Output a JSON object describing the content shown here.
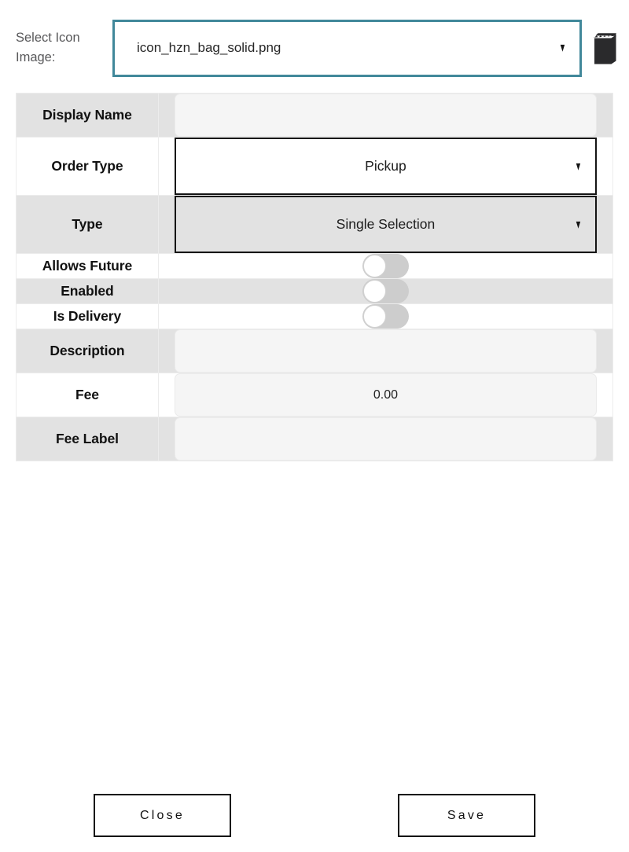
{
  "icon_select": {
    "label": "Select Icon Image:",
    "value": "icon_hzn_bag_solid.png",
    "caret_glyph": "▼",
    "preview_icon": "shopping-bag-icon",
    "border_color": "#41889a",
    "icon_color": "#2a2a2c"
  },
  "form": {
    "rows": [
      {
        "label": "Display Name",
        "control": "text",
        "value": "",
        "placeholder": "",
        "shaded": true
      },
      {
        "label": "Order Type",
        "control": "select",
        "value": "Pickup",
        "placeholder": "",
        "shaded": false
      },
      {
        "label": "Type",
        "control": "select",
        "value": "Single Selection",
        "placeholder": "",
        "shaded": true
      },
      {
        "label": "Allows Future",
        "control": "toggle",
        "value": "off",
        "placeholder": "",
        "shaded": false
      },
      {
        "label": "Enabled",
        "control": "toggle",
        "value": "off",
        "placeholder": "",
        "shaded": true
      },
      {
        "label": "Is Delivery",
        "control": "toggle",
        "value": "off",
        "placeholder": "",
        "shaded": false
      },
      {
        "label": "Description",
        "control": "text",
        "value": "",
        "placeholder": "",
        "shaded": true
      },
      {
        "label": "Fee",
        "control": "text",
        "value": "0.00",
        "placeholder": "",
        "shaded": false
      },
      {
        "label": "Fee Label",
        "control": "text",
        "value": "",
        "placeholder": "",
        "shaded": true
      }
    ]
  },
  "footer": {
    "close_label": "Close",
    "save_label": "Save"
  }
}
